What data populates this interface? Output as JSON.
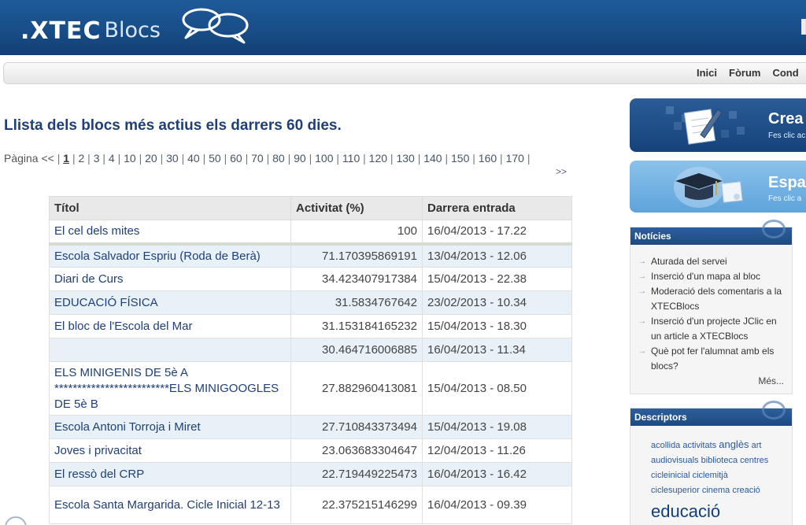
{
  "header": {
    "logo_xtec": ".XTEC",
    "logo_blocs": "Blocs"
  },
  "nav": {
    "items": [
      "Inici",
      "Fòrum",
      "Cond"
    ]
  },
  "main": {
    "title": "Llista dels blocs més actius els darrers 60 dies.",
    "pager": {
      "label": "Pàgina",
      "prev": "<<",
      "current": "1",
      "pages": [
        "2",
        "3",
        "4",
        "10",
        "20",
        "30",
        "40",
        "50",
        "60",
        "70",
        "80",
        "90",
        "100",
        "110",
        "120",
        "130",
        "140",
        "150",
        "160",
        "170"
      ],
      "next": ">>"
    },
    "table": {
      "headers": [
        "Títol",
        "Activitat (%)",
        "Darrera entrada"
      ],
      "rows": [
        {
          "title": "El cel dels mites",
          "activity": "100",
          "date": "16/04/2013 - 17.22"
        },
        {
          "title": "Escola Salvador Espriu (Roda de Berà)",
          "activity": "71.170395869191",
          "date": "13/04/2013 - 12.06"
        },
        {
          "title": "Diari de Curs",
          "activity": "34.423407917384",
          "date": "15/04/2013 - 22.38"
        },
        {
          "title": "EDUCACIÓ FÍSICA",
          "activity": "31.5834767642",
          "date": "23/02/2013 - 10.34"
        },
        {
          "title": "El bloc de l'Escola del Mar",
          "activity": "31.153184165232",
          "date": "15/04/2013 - 18.30"
        },
        {
          "title": "",
          "activity": "30.464716006885",
          "date": "16/04/2013 - 11.34"
        },
        {
          "title": "ELS MINIGENIS DE 5è A *************************ELS MINIGOOGLES DE 5è B",
          "activity": "27.882960413081",
          "date": "15/04/2013 - 08.50"
        },
        {
          "title": "Escola Antoni Torroja i Miret",
          "activity": "27.710843373494",
          "date": "15/04/2013 - 19.08"
        },
        {
          "title": "Joves i privacitat",
          "activity": "23.063683304647",
          "date": "12/04/2013 - 11.26"
        },
        {
          "title": "El ressò del CRP",
          "activity": "22.719449225473",
          "date": "16/04/2013 - 16.42"
        },
        {
          "title": "Escola Santa Margarida. Cicle Inicial 12-13",
          "activity": "22.375215146299",
          "date": "16/04/2013 - 09.39"
        }
      ]
    }
  },
  "sidebar": {
    "banner_crea": {
      "title": "Crea",
      "sub": "Fes clic ac"
    },
    "banner_espai": {
      "title": "Espa",
      "sub": "Fes clic a"
    },
    "news": {
      "title": "Notícies",
      "items": [
        "Aturada del servei",
        "Inserció d'un mapa al bloc",
        "Moderació dels comentaris a la XTECBlocs",
        "Inserció d'un projecte JClic en un article a XTECBlocs",
        "Què pot fer l'alumnat amb els blocs?"
      ],
      "more": "Més..."
    },
    "tags": {
      "title": "Descriptors",
      "items": [
        "acollida",
        "activitats",
        "anglès",
        "art",
        "audiovisuals",
        "biblioteca",
        "centres",
        "cicleinicial",
        "ciclemitjà",
        "ciclesuperior",
        "cinema",
        "creació",
        "educació"
      ]
    }
  },
  "colors": {
    "header_blue": "#184d88",
    "title_blue": "#1f3f78",
    "row_alt": "#e8f1f8"
  }
}
